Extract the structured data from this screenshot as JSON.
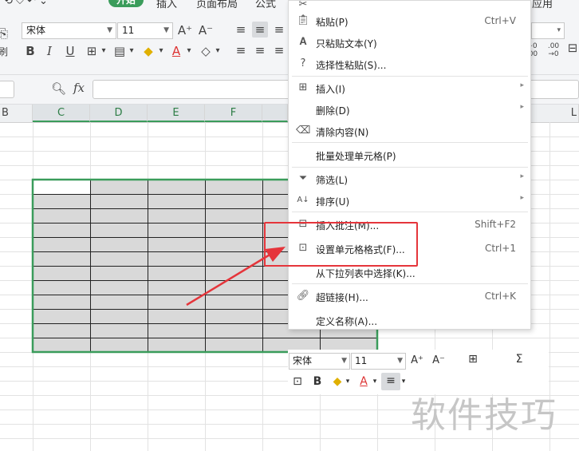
{
  "ribbon": {
    "tabs": [
      {
        "label": "开始",
        "active": true
      },
      {
        "label": "插入",
        "active": false
      },
      {
        "label": "页面布局",
        "active": false
      },
      {
        "label": "公式",
        "active": false
      },
      {
        "label": "应用",
        "active": false
      }
    ],
    "font_name": "宋体",
    "font_size": "11",
    "increase_font_label": "A⁺",
    "decrease_font_label": "A⁻"
  },
  "formula_bar": {
    "fx_label": "fx",
    "value": ""
  },
  "columns": [
    "B",
    "C",
    "D",
    "E",
    "F",
    "L"
  ],
  "context_menu": {
    "items": [
      {
        "label": "粘贴(P)",
        "shortcut": "Ctrl+V",
        "icon": "paste-icon",
        "submenu": false
      },
      {
        "label": "只粘贴文本(Y)",
        "shortcut": "",
        "icon": "paste-text-icon",
        "submenu": false
      },
      {
        "label": "选择性粘贴(S)...",
        "shortcut": "",
        "icon": "paste-special-icon",
        "submenu": false
      },
      {
        "label": "插入(I)",
        "shortcut": "",
        "icon": "insert-icon",
        "submenu": true
      },
      {
        "label": "删除(D)",
        "shortcut": "",
        "icon": "",
        "submenu": true
      },
      {
        "label": "清除内容(N)",
        "shortcut": "",
        "icon": "eraser-icon",
        "submenu": false
      },
      {
        "label": "批量处理单元格(P)",
        "shortcut": "",
        "icon": "",
        "submenu": false
      },
      {
        "label": "筛选(L)",
        "shortcut": "",
        "icon": "filter-icon",
        "submenu": true
      },
      {
        "label": "排序(U)",
        "shortcut": "",
        "icon": "sort-icon",
        "submenu": true
      },
      {
        "label": "插入批注(M)...",
        "shortcut": "Shift+F2",
        "icon": "comment-icon",
        "submenu": false
      },
      {
        "label": "设置单元格格式(F)...",
        "shortcut": "Ctrl+1",
        "icon": "format-cells-icon",
        "submenu": false
      },
      {
        "label": "从下拉列表中选择(K)...",
        "shortcut": "",
        "icon": "",
        "submenu": false
      },
      {
        "label": "超链接(H)...",
        "shortcut": "Ctrl+K",
        "icon": "link-icon",
        "submenu": false
      },
      {
        "label": "定义名称(A)...",
        "shortcut": "",
        "icon": "",
        "submenu": false
      }
    ]
  },
  "mini_toolbar": {
    "font_name": "宋体",
    "font_size": "11",
    "bold_label": "B",
    "font_color_label": "A"
  },
  "colors": {
    "accent": "#3a9c5b",
    "selection_fill": "#d9d9d9",
    "highlight_red": "#e5353b"
  },
  "watermark": "软件技巧"
}
